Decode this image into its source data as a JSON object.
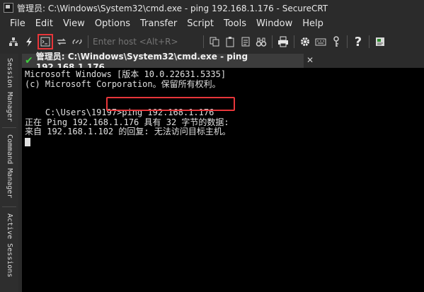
{
  "window": {
    "title": "管理员: C:\\Windows\\System32\\cmd.exe - ping  192.168.1.176 - SecureCRT"
  },
  "menu": [
    "File",
    "Edit",
    "View",
    "Options",
    "Transfer",
    "Script",
    "Tools",
    "Window",
    "Help"
  ],
  "toolbar": {
    "quick_connect_placeholder": "Enter host <Alt+R>",
    "icons": [
      "connect-icon",
      "quick-connect-icon",
      "connect-shell-icon",
      "reconnect-icon",
      "disconnect-icon",
      "copy-icon",
      "paste-icon",
      "find-icon",
      "binoculars-icon",
      "print-icon",
      "settings-icon",
      "keymap-icon",
      "key-icon",
      "help-icon",
      "clipboard-icon"
    ]
  },
  "sidebar": {
    "tabs": [
      "Session Manager",
      "Command Manager",
      "Active Sessions"
    ]
  },
  "session_tab": {
    "label": "管理员: C:\\Windows\\System32\\cmd.exe - ping  192.168.1.176"
  },
  "terminal": {
    "lines": [
      "Microsoft Windows [版本 10.0.22631.5335]",
      "(c) Microsoft Corporation。保留所有权利。",
      "",
      "C:\\Users\\19197>ping 192.168.1.176",
      "",
      "正在 Ping 192.168.1.176 具有 32 字节的数据:",
      "来自 192.168.1.102 的回复: 无法访问目标主机。"
    ]
  },
  "colors": {
    "highlight": "#e8363a",
    "active_check": "#3fcf3f",
    "terminal_bg": "#000000"
  }
}
